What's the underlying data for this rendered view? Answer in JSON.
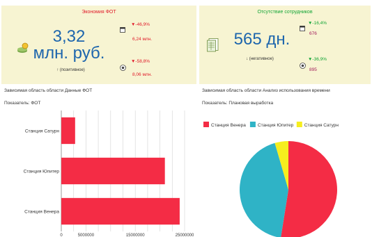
{
  "kpi_left": {
    "title": "Экономия ФОТ",
    "value_line1": "3,32",
    "value_line2": "млн. руб.",
    "note": "↑ (позитивное)",
    "delta1": "▼-46,9%",
    "value1": "6,24 млн.",
    "delta2": "▼-58,8%",
    "value2": "8,06 млн.",
    "colors": {
      "title": "#e01b2a",
      "value": "#1e66ad",
      "delta": "#e01b2a"
    }
  },
  "kpi_right": {
    "title": "Отсутствие сотрудников",
    "value": "565 дн.",
    "note": "↓ (негативное)",
    "delta1": "▼-16,4%",
    "value1": "676",
    "delta2": "▼-36,9%",
    "value2": "895",
    "colors": {
      "title": "#13a536",
      "delta": "#13a536",
      "value": "#a0195a"
    }
  },
  "left_panel": {
    "title": "Зависимая область области Данные ФОТ",
    "metric": "Показатель:  ФОТ"
  },
  "right_panel": {
    "title": "Зависимая область области Анализ использования времени",
    "metric": "Показатель:  Плановая выработка"
  },
  "chart_data": [
    {
      "type": "bar",
      "orientation": "horizontal",
      "categories": [
        "Станция Сатурн",
        "Станция Юпитер",
        "Станция Венера"
      ],
      "values": [
        2800000,
        21000000,
        24000000
      ],
      "xlim": [
        0,
        25000000
      ],
      "xticks": [
        "0",
        "5000000",
        "15000000",
        "25000000"
      ],
      "grid": true,
      "color": "#f42c45"
    },
    {
      "type": "pie",
      "legend_position": "top",
      "labels": [
        "Станция Венера",
        "Станция Юпитер",
        "Станция Сатурн"
      ],
      "values": [
        52.5,
        43,
        4.5
      ],
      "colors": [
        "#f42c45",
        "#2fb3c6",
        "#f6ee1e"
      ]
    }
  ]
}
